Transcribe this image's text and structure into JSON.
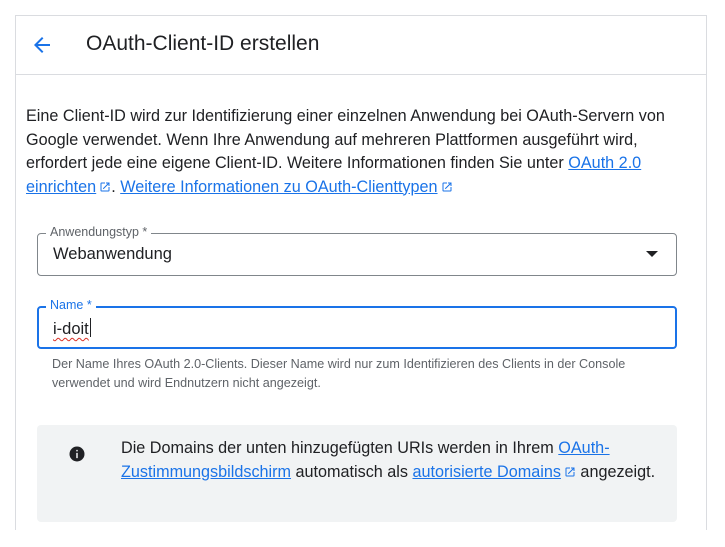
{
  "header": {
    "title": "OAuth-Client-ID erstellen",
    "back_icon": "arrow-back-icon"
  },
  "intro": {
    "text_1": "Eine Client-ID wird zur Identifizierung einer einzelnen Anwendung bei OAuth-Servern von Google verwendet. Wenn Ihre Anwendung auf mehreren Plattformen ausgeführt wird, erfordert jede eine eigene Client-ID. Weitere Informationen finden Sie unter ",
    "link_1": "OAuth 2.0 einrichten",
    "text_2": ". ",
    "link_2": "Weitere Informationen zu OAuth-Clienttypen"
  },
  "app_type": {
    "label": "Anwendungstyp *",
    "value": "Webanwendung"
  },
  "name_field": {
    "label": "Name *",
    "value": "i-doit",
    "hint": "Der Name Ihres OAuth 2.0-Clients. Dieser Name wird nur zum Identifizieren des Clients in der Console verwendet und wird Endnutzern nicht angezeigt."
  },
  "info": {
    "text_1": "Die Domains der unten hinzugefügten URIs werden in Ihrem ",
    "link_1": "OAuth-Zustimmungsbildschirm",
    "text_2": " automatisch als ",
    "link_2": "autorisierte Domains",
    "text_3": " angezeigt."
  },
  "colors": {
    "accent": "#1a73e8",
    "text": "#202124",
    "muted": "#5f6368",
    "border": "#dadce0",
    "info_bg": "#f1f3f4"
  }
}
